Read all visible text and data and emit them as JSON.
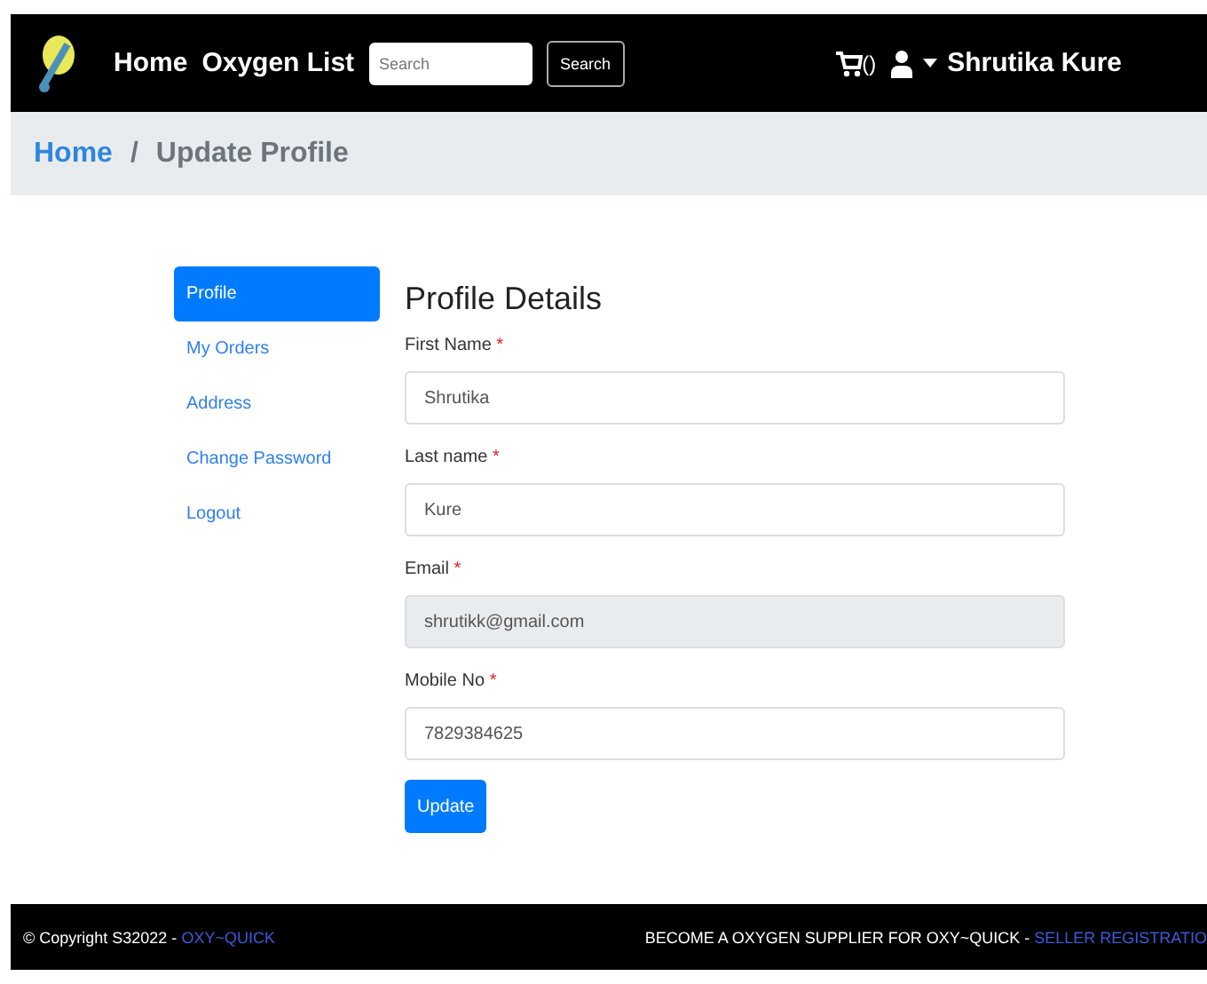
{
  "navbar": {
    "links": [
      {
        "label": "Home"
      },
      {
        "label": "Oxygen List"
      }
    ],
    "search": {
      "placeholder": "Search"
    },
    "search_button": "Search",
    "cart_count": "()",
    "user_name": "Shrutika Kure"
  },
  "breadcrumb": [
    {
      "label": "Home",
      "link": true
    },
    {
      "label": "/",
      "link": false
    },
    {
      "label": "Update Profile",
      "link": false
    }
  ],
  "sidebar": {
    "items": [
      {
        "label": "Profile",
        "selected": true
      },
      {
        "label": "My Orders",
        "selected": false
      },
      {
        "label": "Address",
        "selected": false
      },
      {
        "label": "Change Password",
        "selected": false
      },
      {
        "label": "Logout",
        "selected": false
      }
    ]
  },
  "form": {
    "title": "Profile Details",
    "fields": [
      {
        "label": "First Name",
        "required_mark": "*",
        "value": "Shrutika",
        "disabled": false
      },
      {
        "label": "Last name",
        "required_mark": "*",
        "value": "Kure",
        "disabled": false
      },
      {
        "label": "Email",
        "required_mark": "*",
        "value": "shrutikk@gmail.com",
        "disabled": true
      },
      {
        "label": "Mobile No",
        "required_mark": "*",
        "value": "7829384625",
        "disabled": false
      }
    ],
    "button": "Update"
  },
  "footer": {
    "copyright": "© Copyright S32022 - ",
    "brand_link": "OXY~QUICK",
    "promo": "BECOME A OXYGEN SUPPLIER FOR OXY~QUICK - ",
    "promo_link": "SELLER REGISTRATIO"
  }
}
